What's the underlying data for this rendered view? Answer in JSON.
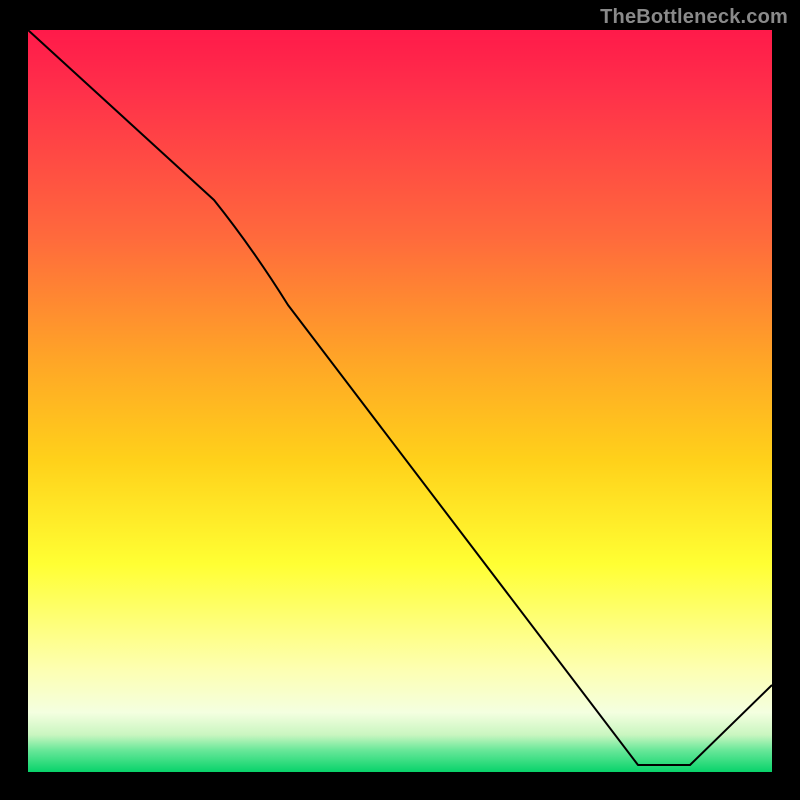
{
  "watermark": "TheBottleneck.com",
  "annotation_near_minimum": "",
  "chart_data": {
    "type": "line",
    "title": "",
    "xlabel": "",
    "ylabel": "",
    "xlim": [
      0,
      100
    ],
    "ylim": [
      0,
      100
    ],
    "background_gradient": {
      "from_top": [
        "#ff1a4a",
        "#ff6a3c",
        "#ffd11a",
        "#ffff33",
        "#f8ffd0",
        "#08d36a"
      ],
      "stops_percent": [
        0,
        28,
        55,
        72,
        92,
        100
      ]
    },
    "series": [
      {
        "name": "bottleneck_curve",
        "x": [
          0,
          25,
          82,
          89,
          100
        ],
        "values": [
          100,
          77,
          1,
          1,
          12
        ]
      }
    ],
    "notes": "Line descends from top-left, bends steeper after ~x=25, reaches a flat minimum near x≈82–89 close to y≈0, then rises slightly toward the right edge. Background is a vertical red→orange→yellow→pale→green gradient (green at bottom)."
  }
}
